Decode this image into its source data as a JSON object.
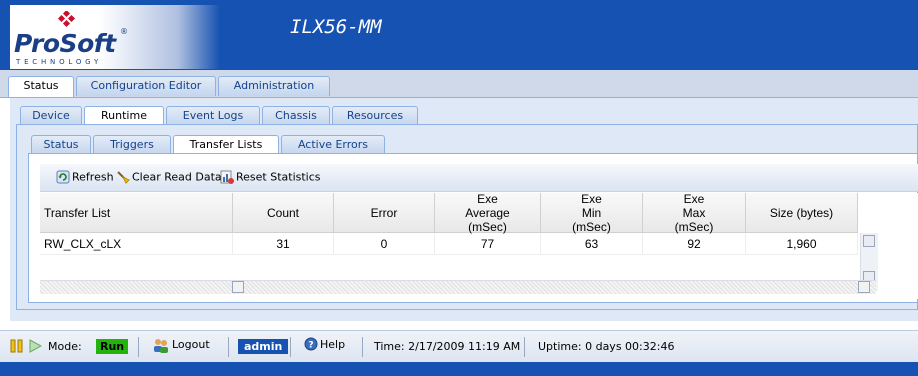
{
  "app": {
    "brand": "ProSoft",
    "brand_sub": "TECHNOLOGY",
    "title": "ILX56-MM"
  },
  "main_tabs": [
    {
      "label": "Status",
      "active": true
    },
    {
      "label": "Configuration Editor",
      "active": false
    },
    {
      "label": "Administration",
      "active": false
    }
  ],
  "sub_tabs": [
    {
      "label": "Device",
      "active": false
    },
    {
      "label": "Runtime",
      "active": true
    },
    {
      "label": "Event Logs",
      "active": false
    },
    {
      "label": "Chassis",
      "active": false
    },
    {
      "label": "Resources",
      "active": false
    }
  ],
  "runtime_tabs": [
    {
      "label": "Status",
      "active": false
    },
    {
      "label": "Triggers",
      "active": false
    },
    {
      "label": "Transfer Lists",
      "active": true
    },
    {
      "label": "Active Errors",
      "active": false
    }
  ],
  "toolbar": {
    "refresh": "Refresh",
    "clear": "Clear Read Data",
    "reset": "Reset Statistics"
  },
  "grid": {
    "headers": [
      "Transfer List",
      "Count",
      "Error",
      "Exe Average (mSec)",
      "Exe Min (mSec)",
      "Exe Max (mSec)",
      "Size (bytes)"
    ],
    "rows": [
      [
        "RW_CLX_cLX",
        "31",
        "0",
        "77",
        "63",
        "92",
        "1,960"
      ]
    ]
  },
  "statusbar": {
    "mode_label": "Mode:",
    "mode_value": "Run",
    "logout": "Logout",
    "user": "admin",
    "help": "Help",
    "time": "Time: 2/17/2009 11:19 AM",
    "uptime": "Uptime: 0 days 00:32:46"
  },
  "colors": {
    "header_blue": "#1652b1",
    "run_green": "#22b40d",
    "admin_blue": "#1652b1"
  }
}
